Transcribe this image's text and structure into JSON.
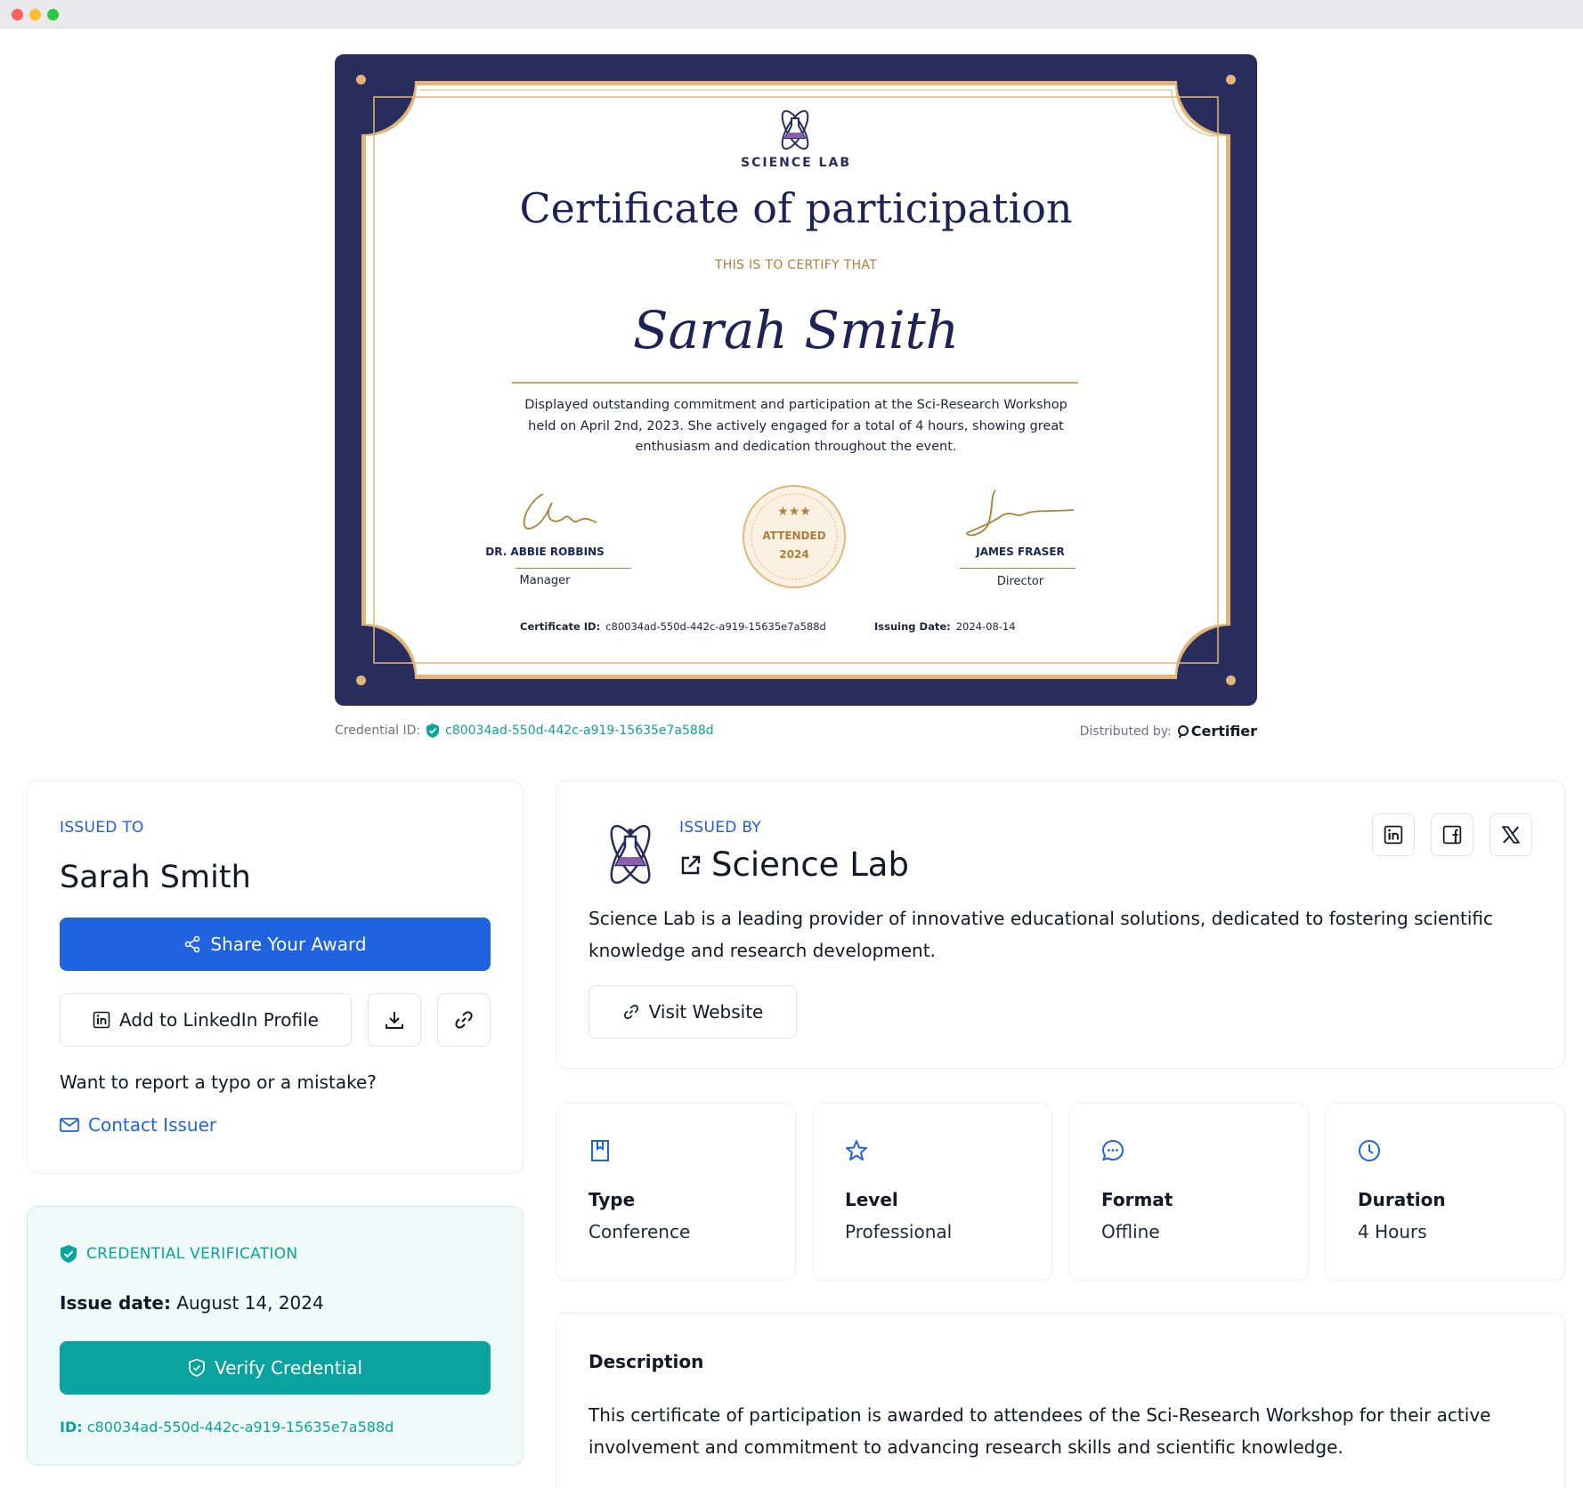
{
  "certificate": {
    "org_name": "SCIENCE LAB",
    "title": "Certificate of participation",
    "subtitle": "THIS IS TO CERTIFY THAT",
    "recipient": "Sarah Smith",
    "description": "Displayed outstanding commitment and participation at the Sci-Research Workshop held on April 2nd, 2023. She actively engaged for a total of 4 hours, showing great enthusiasm and dedication throughout the event.",
    "signer_left": {
      "name": "DR. ABBIE ROBBINS",
      "role": "Manager"
    },
    "signer_right": {
      "name": "JAMES FRASER",
      "role": "Director"
    },
    "seal": {
      "stars": "★★★",
      "line1": "ATTENDED",
      "line2": "2024"
    },
    "cert_id_label": "Certificate ID:",
    "cert_id": "c80034ad-550d-442c-a919-15635e7a588d",
    "issuing_label": "Issuing Date:",
    "issuing_date": "2024-08-14"
  },
  "credential_bar": {
    "label": "Credential ID:",
    "id": "c80034ad-550d-442c-a919-15635e7a588d",
    "distributed_label": "Distributed by:",
    "brand": "Certifier"
  },
  "issued_to": {
    "eyebrow": "ISSUED TO",
    "name": "Sarah Smith",
    "share_label": "Share Your Award",
    "linkedin_label": "Add to LinkedIn Profile",
    "report_text": "Want to report a typo or a mistake?",
    "contact_label": "Contact Issuer"
  },
  "verification": {
    "eyebrow": "CREDENTIAL VERIFICATION",
    "issue_label": "Issue date:",
    "issue_date": "August 14, 2024",
    "verify_label": "Verify Credential",
    "id_label": "ID:",
    "id": "c80034ad-550d-442c-a919-15635e7a588d"
  },
  "issued_by": {
    "eyebrow": "ISSUED BY",
    "name": "Science Lab",
    "about": "Science Lab is a leading provider of innovative educational solutions, dedicated to fostering scientific knowledge and research development.",
    "website_label": "Visit Website"
  },
  "stats": [
    {
      "icon": "bookmark-icon",
      "label": "Type",
      "value": "Conference"
    },
    {
      "icon": "star-icon",
      "label": "Level",
      "value": "Professional"
    },
    {
      "icon": "chat-bubble-icon",
      "label": "Format",
      "value": "Offline"
    },
    {
      "icon": "clock-icon",
      "label": "Duration",
      "value": "4 Hours"
    }
  ],
  "description": {
    "heading": "Description",
    "text": "This certificate of participation is awarded to attendees of the Sci-Research Workshop for their active involvement and commitment to advancing research skills and scientific knowledge."
  },
  "colors": {
    "primary": "#1f63e0",
    "teal": "#0aa39f",
    "navy": "#292d5e",
    "gold": "#e3b677"
  }
}
